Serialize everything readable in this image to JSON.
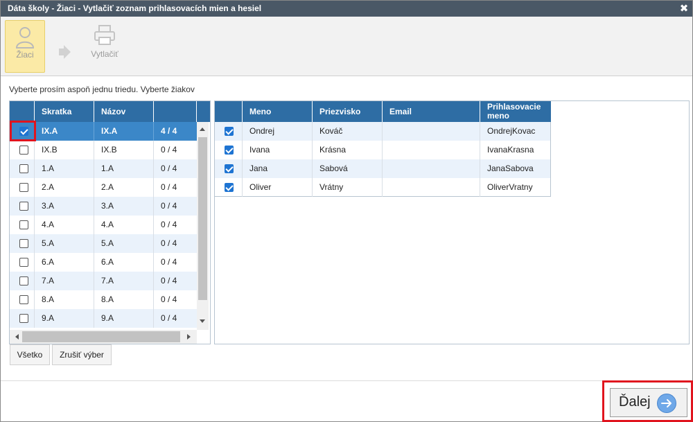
{
  "window": {
    "title": "Dáta školy - Žiaci - Vytlačiť zoznam prihlasovacích mien a hesiel",
    "close_icon": "close-icon"
  },
  "toolbar": {
    "students_label": "Žiaci",
    "print_label": "Vytlačiť"
  },
  "instruction": "Vyberte prosím aspoň jednu triedu. Vyberte žiakov",
  "classes": {
    "headers": [
      "Skratka",
      "Názov",
      ""
    ],
    "rows": [
      {
        "checked": true,
        "short": "IX.A",
        "name": "IX.A",
        "count": "4 / 4",
        "selected": true
      },
      {
        "checked": false,
        "short": "IX.B",
        "name": "IX.B",
        "count": "0 / 4"
      },
      {
        "checked": false,
        "short": "1.A",
        "name": "1.A",
        "count": "0 / 4"
      },
      {
        "checked": false,
        "short": "2.A",
        "name": "2.A",
        "count": "0 / 4"
      },
      {
        "checked": false,
        "short": "3.A",
        "name": "3.A",
        "count": "0 / 4"
      },
      {
        "checked": false,
        "short": "4.A",
        "name": "4.A",
        "count": "0 / 4"
      },
      {
        "checked": false,
        "short": "5.A",
        "name": "5.A",
        "count": "0 / 4"
      },
      {
        "checked": false,
        "short": "6.A",
        "name": "6.A",
        "count": "0 / 4"
      },
      {
        "checked": false,
        "short": "7.A",
        "name": "7.A",
        "count": "0 / 4"
      },
      {
        "checked": false,
        "short": "8.A",
        "name": "8.A",
        "count": "0 / 4"
      },
      {
        "checked": false,
        "short": "9.A",
        "name": "9.A",
        "count": "0 / 4"
      }
    ]
  },
  "students": {
    "headers": [
      "Meno",
      "Priezvisko",
      "Email",
      "Prihlasovacie meno"
    ],
    "rows": [
      {
        "checked": true,
        "first": "Ondrej",
        "last": "Kováč",
        "email": "",
        "login": "OndrejKovac"
      },
      {
        "checked": true,
        "first": "Ivana",
        "last": "Krásna",
        "email": "",
        "login": "IvanaKrasna"
      },
      {
        "checked": true,
        "first": "Jana",
        "last": "Sabová",
        "email": "",
        "login": "JanaSabova"
      },
      {
        "checked": true,
        "first": "Oliver",
        "last": "Vrátny",
        "email": "",
        "login": "OliverVratny"
      }
    ]
  },
  "buttons": {
    "all": "Všetko",
    "clear": "Zrušiť výber",
    "next": "Ďalej"
  },
  "colors": {
    "header": "#2e6da4",
    "selected_row": "#3b87c8",
    "highlight": "#e0141e",
    "toolbar_active": "#fbeaa6"
  }
}
